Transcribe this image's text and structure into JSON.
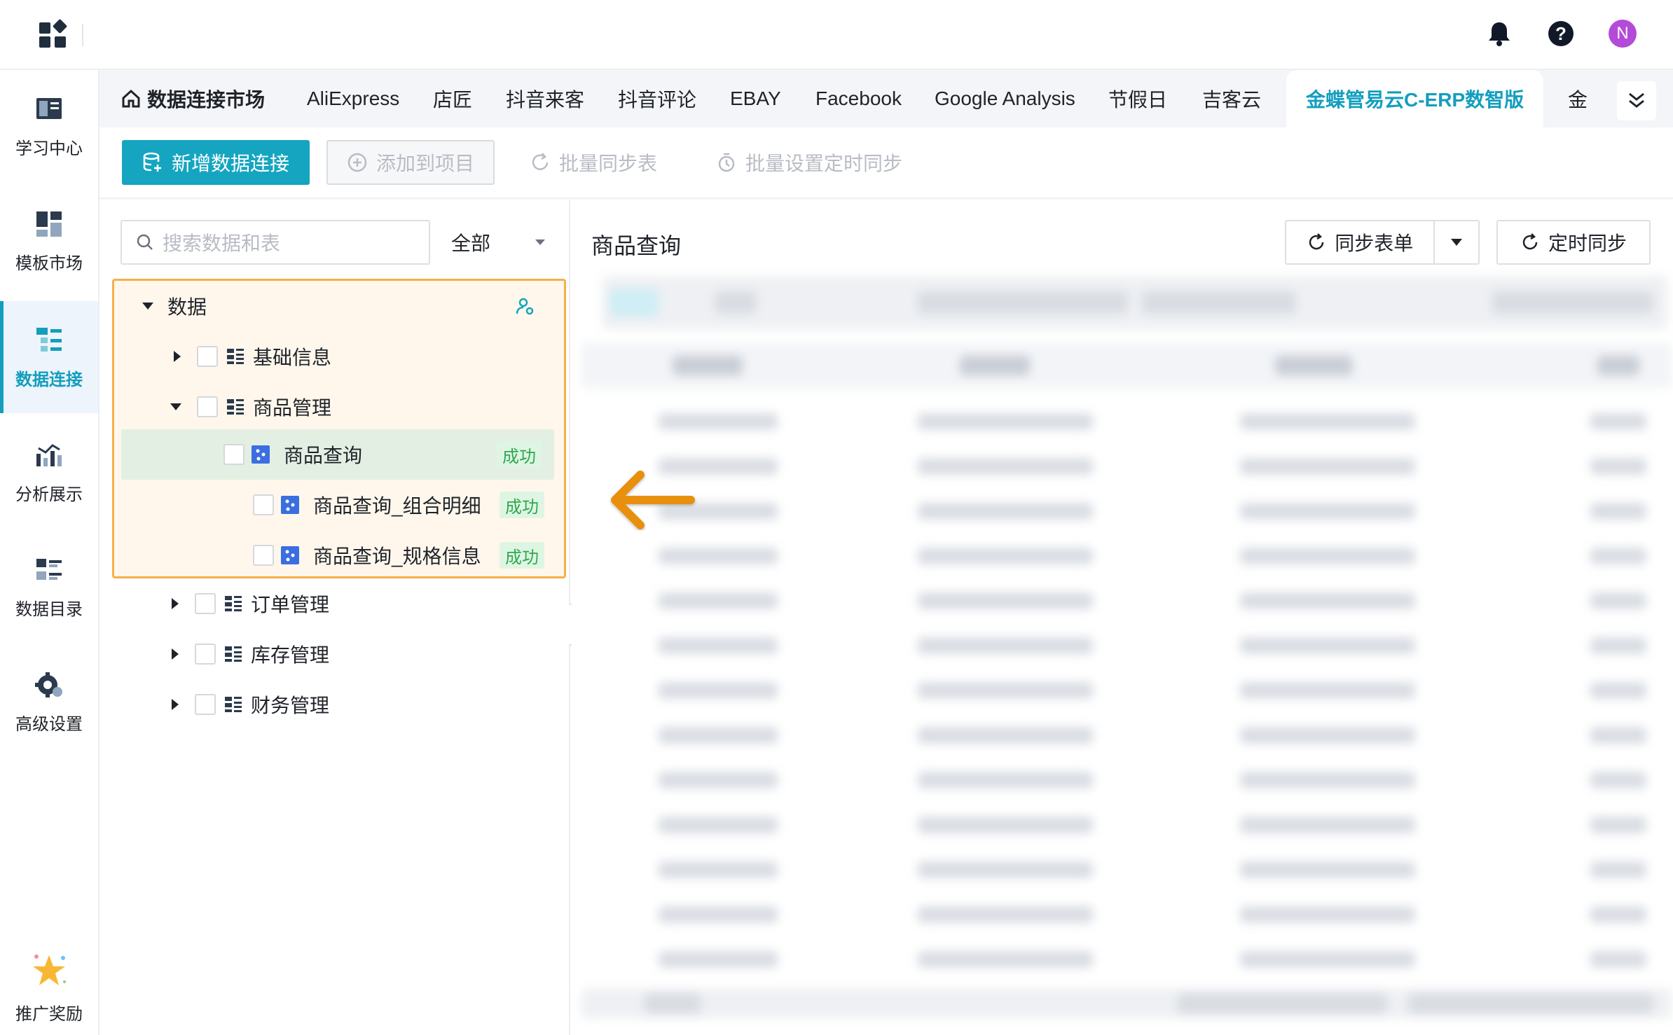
{
  "sidebar": {
    "items": [
      {
        "label": "学习中心",
        "icon": "learning-center-icon"
      },
      {
        "label": "模板市场",
        "icon": "template-market-icon"
      },
      {
        "label": "数据连接",
        "icon": "data-connection-icon",
        "active": true
      },
      {
        "label": "分析展示",
        "icon": "analysis-icon"
      },
      {
        "label": "数据目录",
        "icon": "data-catalog-icon"
      },
      {
        "label": "高级设置",
        "icon": "gear-icon"
      }
    ],
    "promo": {
      "label": "推广奖励",
      "icon": "star-icon"
    }
  },
  "topbar": {
    "avatar_letter": "N",
    "help_glyph": "?"
  },
  "tabs": {
    "home": "数据连接市场",
    "items": [
      "AliExpress",
      "店匠",
      "抖音来客",
      "抖音评论",
      "EBAY",
      "Facebook",
      "Google Analysis",
      "节假日",
      "吉客云"
    ],
    "active": "金蝶管易云C-ERP数智版",
    "overflow": "金"
  },
  "toolbar": {
    "add_connection": "新增数据连接",
    "add_to_project": "添加到项目",
    "batch_sync": "批量同步表",
    "batch_schedule": "批量设置定时同步"
  },
  "left": {
    "search_placeholder": "搜索数据和表",
    "filter": "全部",
    "tree": {
      "root": "数据",
      "nodes": {
        "basic": "基础信息",
        "product": "商品管理",
        "product_query": "商品查询",
        "product_query_combo": "商品查询_组合明细",
        "product_query_spec": "商品查询_规格信息",
        "order": "订单管理",
        "inventory": "库存管理",
        "finance": "财务管理"
      },
      "status": "成功"
    }
  },
  "right": {
    "title": "商品查询",
    "sync_table": "同步表单",
    "scheduled_sync": "定时同步"
  },
  "colors": {
    "accent": "#15a5c0",
    "highlight_border": "#f4b04a",
    "arrow": "#e8900c",
    "success": "#2fa84f"
  }
}
